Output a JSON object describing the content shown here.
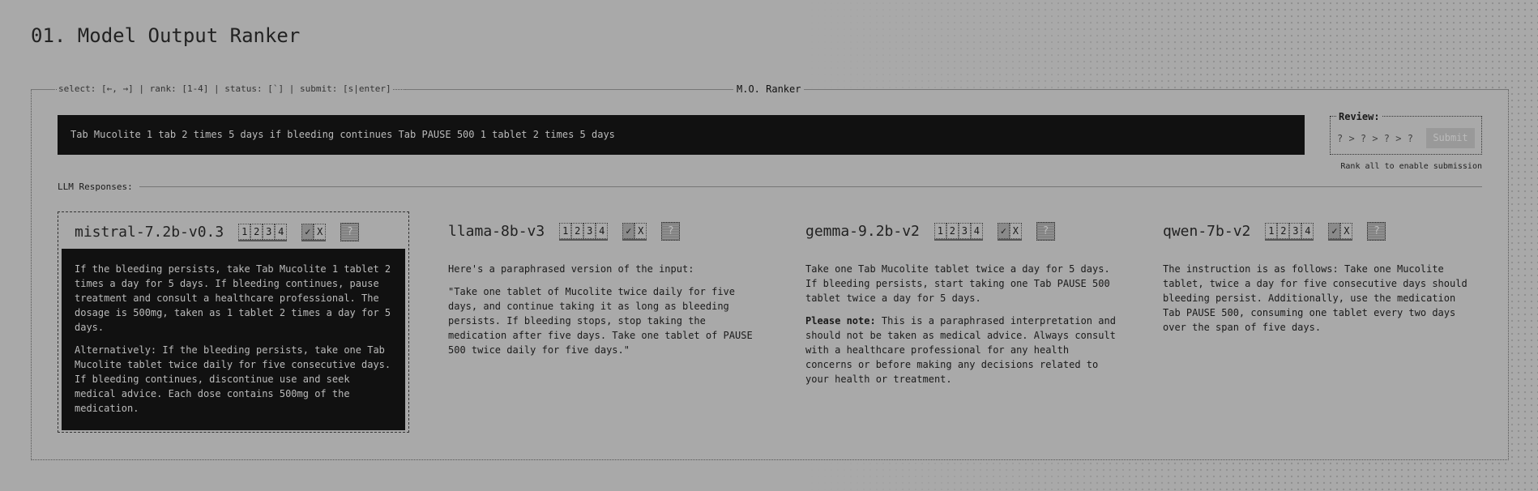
{
  "page_title": "01. Model Output Ranker",
  "panel": {
    "legend": "select: [←, →] | rank: [1-4] | status: [`] | submit: [s|enter]",
    "title": "M.O. Ranker"
  },
  "input_text": "Tab Mucolite 1 tab 2 times 5 days if bleeding continues Tab PAUSE 500 1 tablet 2 times 5 days",
  "review": {
    "label": "Review:",
    "order": "? > ? > ? > ?",
    "submit": "Submit",
    "hint": "Rank all to enable submission"
  },
  "responses_label": "LLM Responses:",
  "rank_options": [
    "1",
    "2",
    "3",
    "4"
  ],
  "status": {
    "check": "✓",
    "x": "X",
    "unknown": "?"
  },
  "responses": [
    {
      "model": "mistral-7.2b-v0.3",
      "paragraphs": [
        "If the bleeding persists, take Tab Mucolite 1 tablet 2 times a day for 5 days. If bleeding continues, pause treatment and consult a healthcare professional. The dosage is 500mg, taken as 1 tablet 2 times a day for 5 days.",
        "Alternatively: If the bleeding persists, take one Tab Mucolite tablet twice daily for five consecutive days. If bleeding continues, discontinue use and seek medical advice. Each dose contains 500mg of the medication."
      ]
    },
    {
      "model": "llama-8b-v3",
      "paragraphs": [
        "Here's a paraphrased version of the input:",
        "\"Take one tablet of Mucolite twice daily for five days, and continue taking it as long as bleeding persists. If bleeding stops, stop taking the medication after five days. Take one tablet of PAUSE 500 twice daily for five days.\""
      ]
    },
    {
      "model": "gemma-9.2b-v2",
      "paragraphs": [
        "Take one Tab Mucolite tablet twice a day for 5 days. If bleeding persists, start taking one Tab PAUSE 500 tablet twice a day for 5 days."
      ],
      "note_label": "Please note:",
      "note": " This is a paraphrased interpretation and should not be taken as medical advice. Always consult with a healthcare professional for any health concerns or before making any decisions related to your health or treatment."
    },
    {
      "model": "qwen-7b-v2",
      "paragraphs": [
        "The instruction is as follows: Take one Mucolite tablet, twice a day for five consecutive days should bleeding persist. Additionally, use the medication Tab PAUSE 500, consuming one tablet every two days over the span of five days."
      ]
    }
  ]
}
